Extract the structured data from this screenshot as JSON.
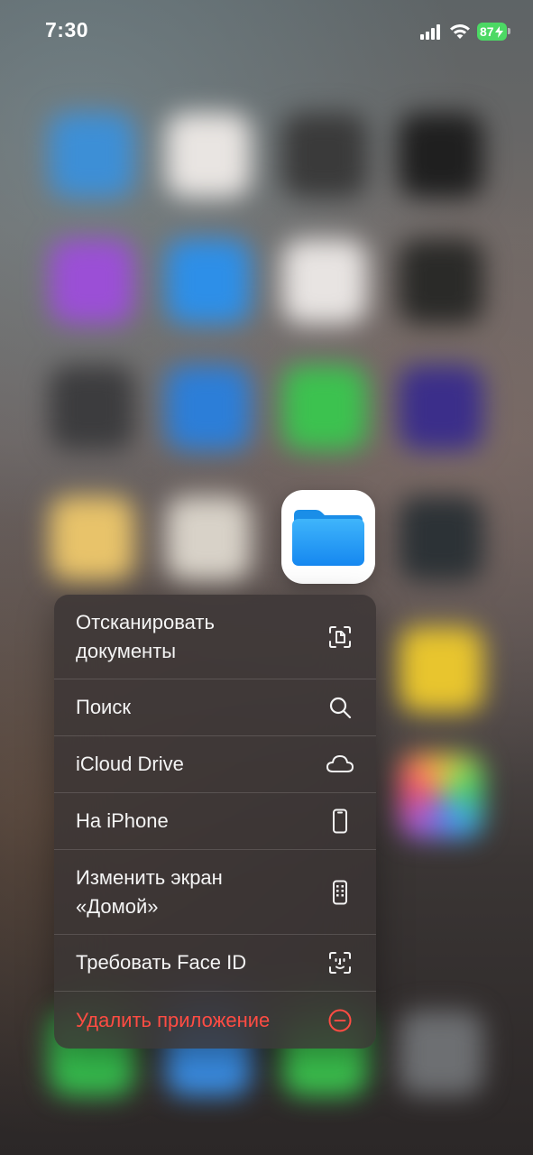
{
  "status_bar": {
    "time": "7:30",
    "battery_percent": "87",
    "charging": true,
    "signal_bars": 4,
    "wifi": true
  },
  "focused_app": {
    "icon": "folder-icon",
    "accent": "#1a9cf7"
  },
  "context_menu": {
    "items": [
      {
        "label": "Отсканировать\nдокументы",
        "icon": "scan-document-icon"
      },
      {
        "label": "Поиск",
        "icon": "search-icon"
      },
      {
        "label": "iCloud Drive",
        "icon": "cloud-icon"
      },
      {
        "label": "На iPhone",
        "icon": "iphone-icon"
      },
      {
        "label": "Изменить экран\n«Домой»",
        "icon": "home-screen-edit-icon"
      },
      {
        "label": "Требовать Face ID",
        "icon": "face-id-icon"
      },
      {
        "label": "Удалить приложение",
        "icon": "minus-circle-icon",
        "destructive": true
      }
    ]
  },
  "colors": {
    "destructive": "#ff4c43",
    "battery": "#4cd964"
  }
}
